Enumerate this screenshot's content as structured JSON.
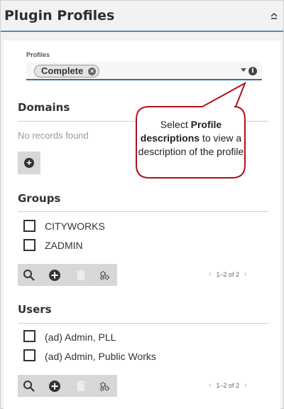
{
  "header": {
    "title": "Plugin Profiles"
  },
  "profiles": {
    "label": "Profiles",
    "selected": [
      {
        "label": "Complete"
      }
    ]
  },
  "callout": {
    "prefix": "Select ",
    "bold": "Profile descriptions",
    "suffix": " to view a description of the profile"
  },
  "domains": {
    "title": "Domains",
    "empty_text": "No records found"
  },
  "groups": {
    "title": "Groups",
    "items": [
      {
        "label": "CITYWORKS"
      },
      {
        "label": "ZADMIN"
      }
    ],
    "pager": "1–2 of 2"
  },
  "users": {
    "title": "Users",
    "items": [
      {
        "label": "(ad) Admin, PLL"
      },
      {
        "label": "(ad) Admin, Public Works"
      }
    ],
    "pager": "1–2 of 2"
  },
  "colors": {
    "accent": "#2b6fb0",
    "callout_border": "#b0121b",
    "toolbar_bg": "#d7d7d7"
  }
}
